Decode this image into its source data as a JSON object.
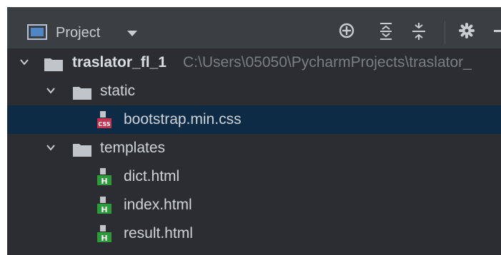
{
  "header": {
    "view_label": "Project"
  },
  "tree": {
    "root": {
      "name": "traslator_fl_1",
      "path": "C:\\Users\\05050\\PycharmProjects\\traslator_"
    },
    "static_folder": {
      "name": "static"
    },
    "static_files": [
      {
        "name": "bootstrap.min.css",
        "type": "css",
        "badge": "CSS",
        "selected": true
      }
    ],
    "templates_folder": {
      "name": "templates"
    },
    "template_files": [
      {
        "name": "dict.html",
        "type": "html",
        "badge": "H"
      },
      {
        "name": "index.html",
        "type": "html",
        "badge": "H"
      },
      {
        "name": "result.html",
        "type": "html",
        "badge": "H"
      }
    ]
  },
  "colors": {
    "background": "#2b2d30",
    "toolbar": "#3c3f41",
    "selection": "#0d2b45",
    "text": "#d0d3d8",
    "path_text": "#7b7f84",
    "css_badge": "#c2334f",
    "html_badge": "#2c9b3a"
  },
  "icons": {
    "toolbar": [
      "locate-icon",
      "expand-all-icon",
      "collapse-all-icon",
      "gear-icon",
      "minimize-icon"
    ]
  }
}
